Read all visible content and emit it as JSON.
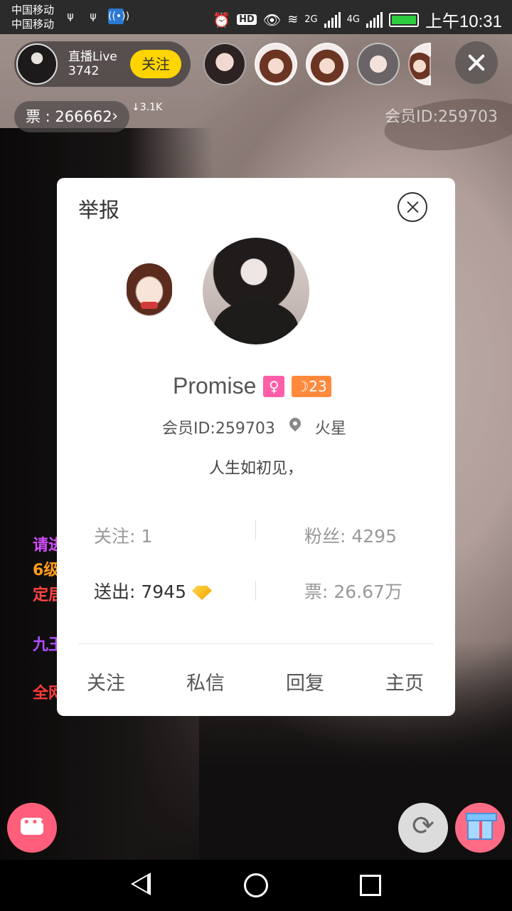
{
  "status_bar": {
    "carrier1": "中国移动",
    "carrier2": "中国移动",
    "network_2g": "2G",
    "network_4g": "4G",
    "hd": "HD",
    "time": "上午10:31"
  },
  "live_header": {
    "host_label": "直播Live",
    "host_number": "3742",
    "follow_label": "关注",
    "ticket_label": "票 : 266662",
    "ticket_delta": "↓3.1K",
    "vip_id": "会员ID:259703"
  },
  "chat_fragments": [
    "请进",
    "6级",
    "定居",
    "九王",
    "全网"
  ],
  "profile_card": {
    "title": "举报",
    "name": "Promise",
    "gender_symbol": "♀",
    "level": "☽23",
    "member_id": "会员ID:259703",
    "location": "火星",
    "bio": "人生如初见，",
    "following": "关注: 1",
    "fans": "粉丝: 4295",
    "sent": "送出: 7945",
    "tickets": "票: 26.67万",
    "actions": {
      "follow": "关注",
      "message": "私信",
      "reply": "回复",
      "homepage": "主页"
    }
  },
  "colors": {
    "follow_yellow": "#ffd400",
    "chat_button": "#ff5f7a",
    "gender_pink": "#ff5fa8",
    "level_orange": "#ff8a3d"
  }
}
